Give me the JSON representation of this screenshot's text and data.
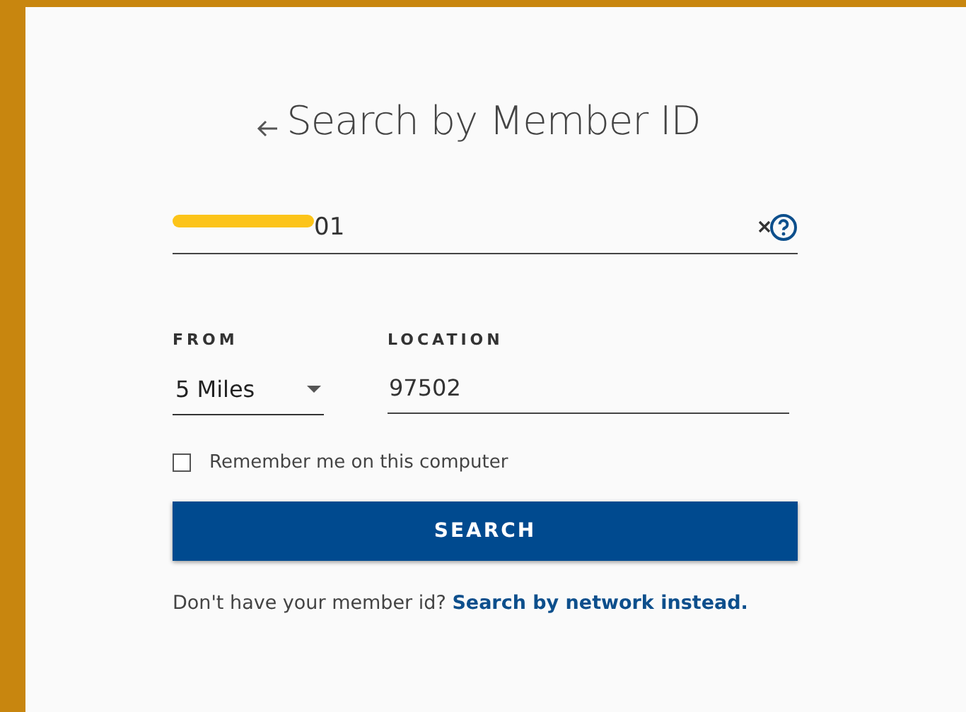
{
  "title": "Search by Member ID",
  "member_id": {
    "value": "01"
  },
  "from": {
    "label": "FROM",
    "value": "5 Miles"
  },
  "location": {
    "label": "LOCATION",
    "value": "97502"
  },
  "remember": {
    "label": "Remember me on this computer",
    "checked": false
  },
  "search_button": "SEARCH",
  "footer": {
    "text": "Don't have your member id?",
    "link": "Search by network instead."
  }
}
